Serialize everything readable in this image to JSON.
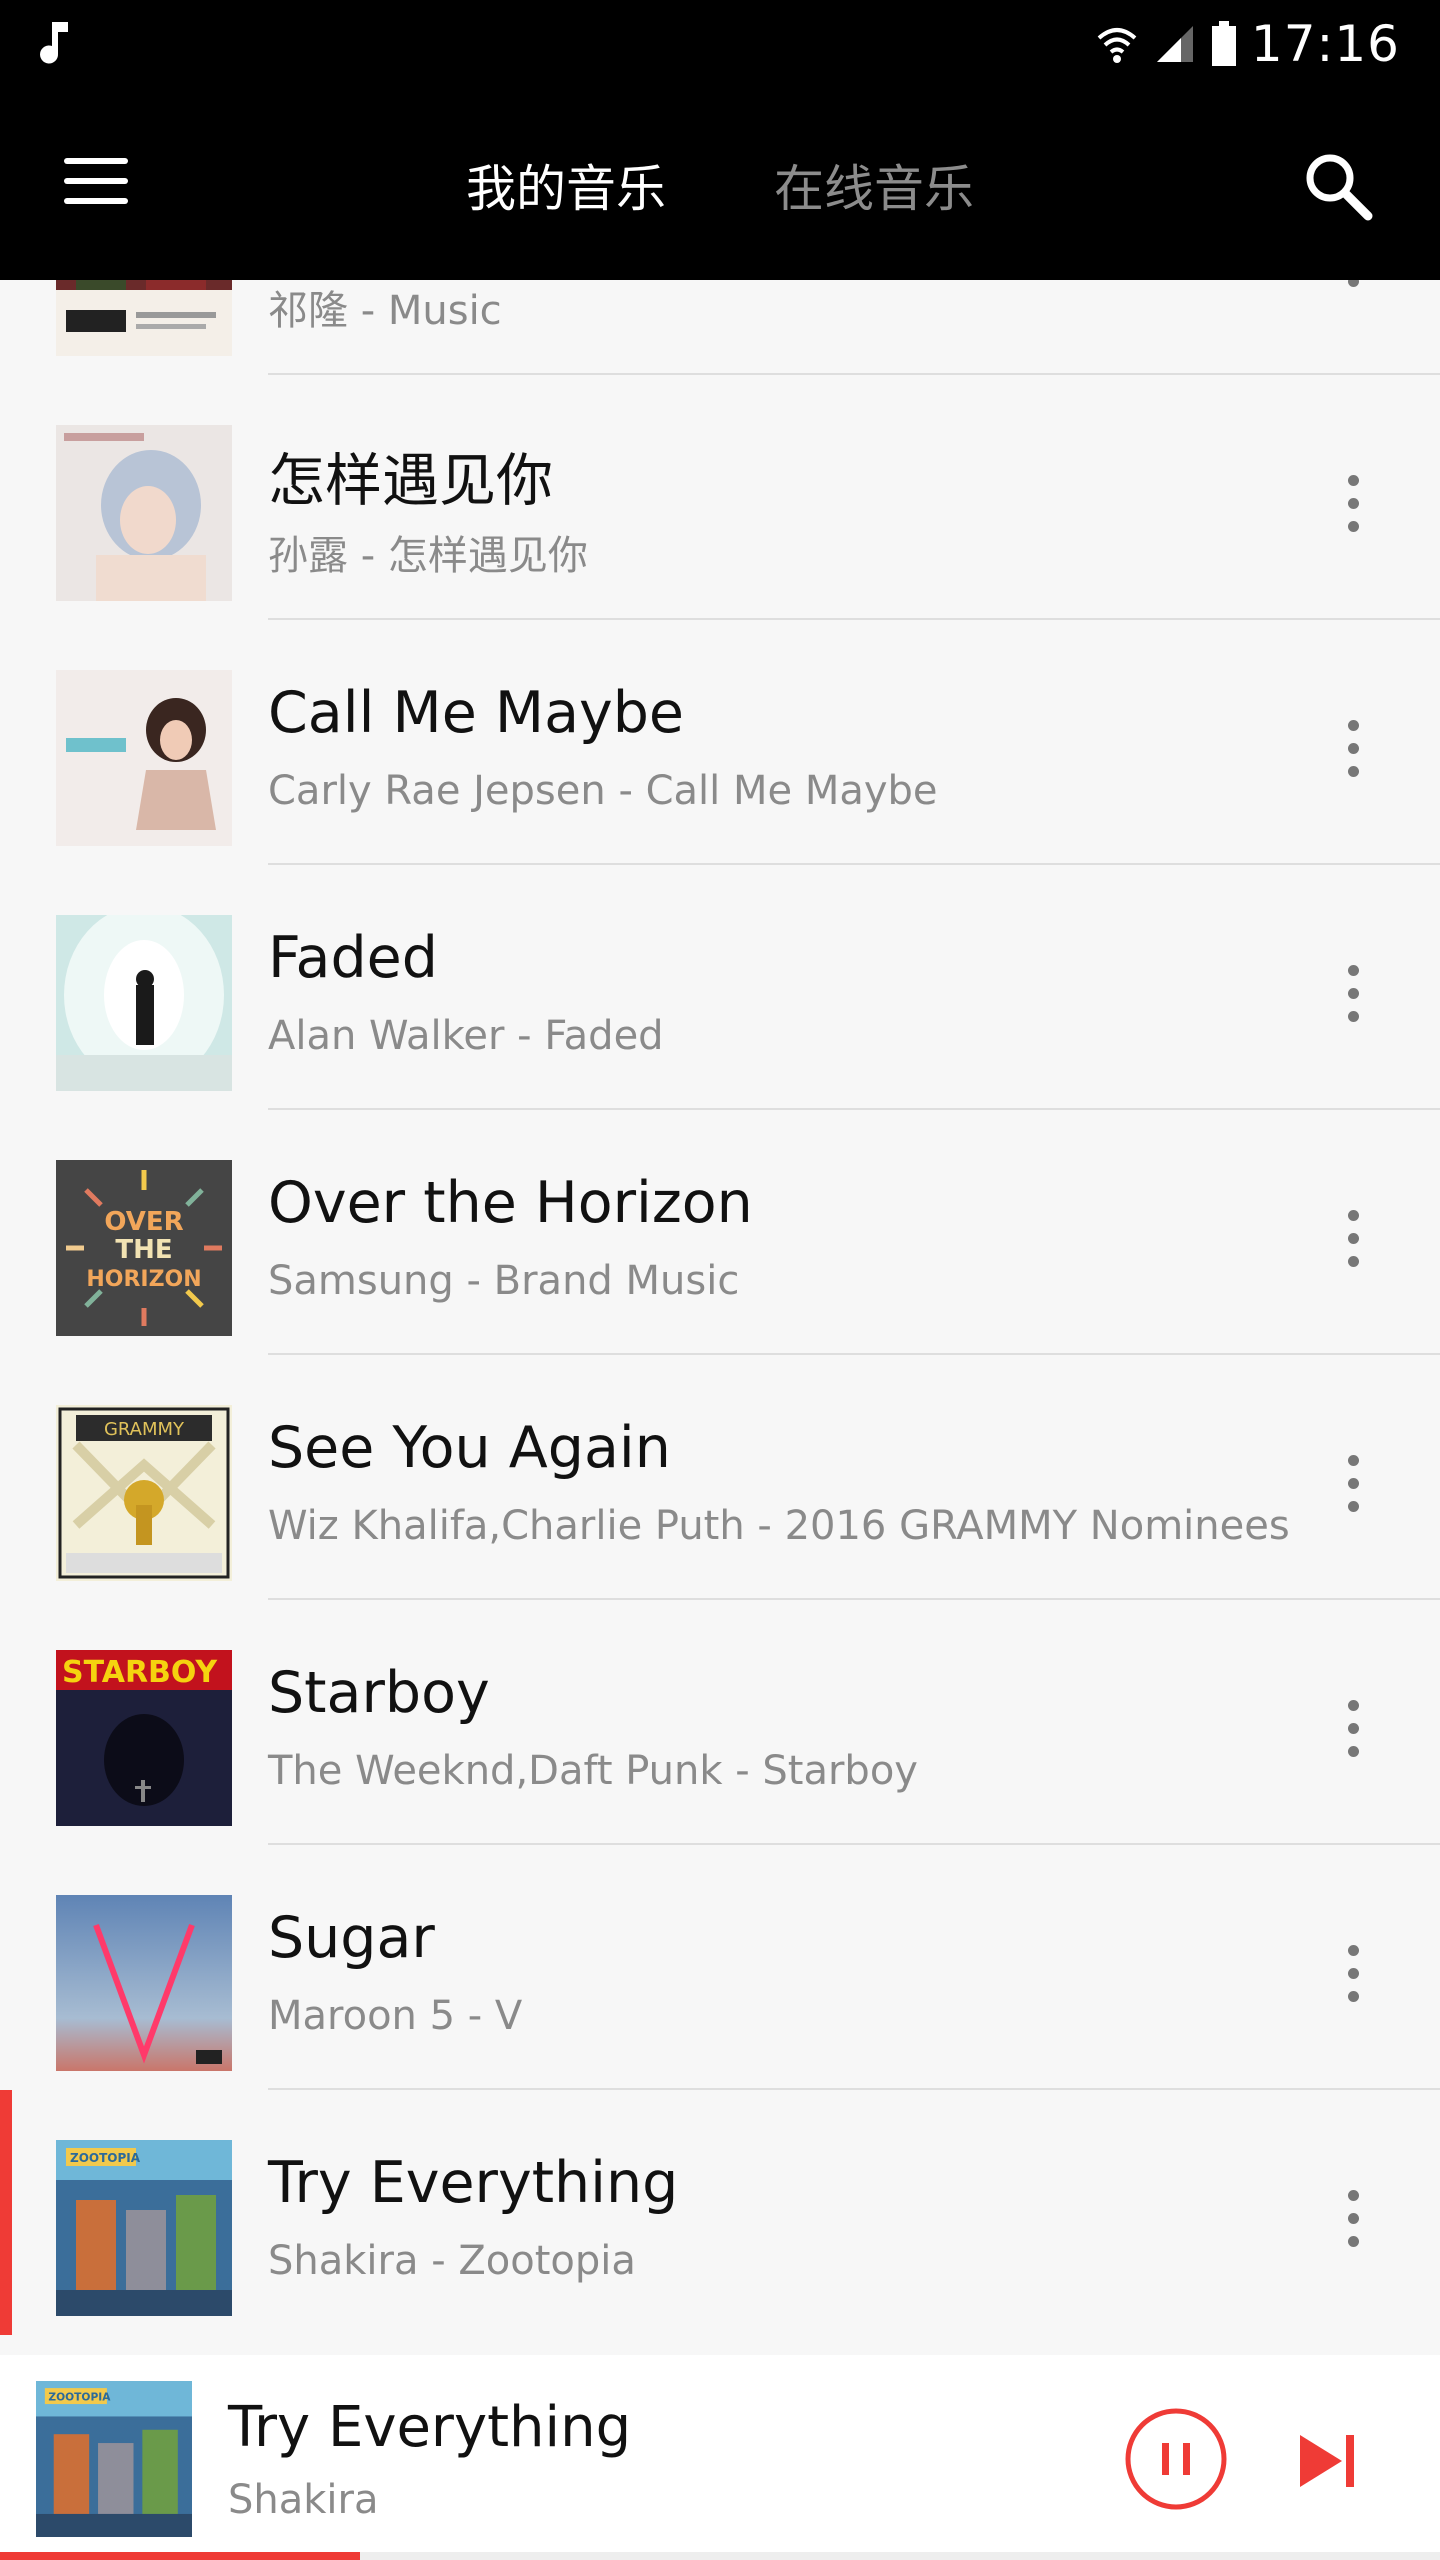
{
  "status_bar": {
    "time": "17:16"
  },
  "app_bar": {
    "tabs": [
      {
        "label": "我的音乐",
        "active": true
      },
      {
        "label": "在线音乐",
        "active": false
      }
    ]
  },
  "songs": [
    {
      "title": "",
      "subtitle": "祁隆 - Music"
    },
    {
      "title": "怎样遇见你",
      "subtitle": "孙露 - 怎样遇见你"
    },
    {
      "title": "Call Me Maybe",
      "subtitle": "Carly Rae Jepsen - Call Me Maybe"
    },
    {
      "title": "Faded",
      "subtitle": "Alan Walker - Faded"
    },
    {
      "title": "Over the Horizon",
      "subtitle": "Samsung - Brand Music"
    },
    {
      "title": "See You Again",
      "subtitle": "Wiz Khalifa,Charlie Puth - 2016 GRAMMY Nominees"
    },
    {
      "title": "Starboy",
      "subtitle": "The Weeknd,Daft Punk - Starboy"
    },
    {
      "title": "Sugar",
      "subtitle": "Maroon 5 - V"
    },
    {
      "title": "Try Everything",
      "subtitle": "Shakira - Zootopia",
      "playing": true
    }
  ],
  "album_art_text": {
    "horizon": [
      "OVER",
      "THE",
      "HORIZON"
    ],
    "grammy": "GRAMMY",
    "starboy": "STARBOY",
    "zootopia": "ZOOTOPIA"
  },
  "now_playing": {
    "title": "Try Everything",
    "artist": "Shakira",
    "progress": 0.25
  },
  "colors": {
    "accent": "#ef3b36",
    "bar_bg": "#000000",
    "list_bg": "#f7f7f7"
  }
}
